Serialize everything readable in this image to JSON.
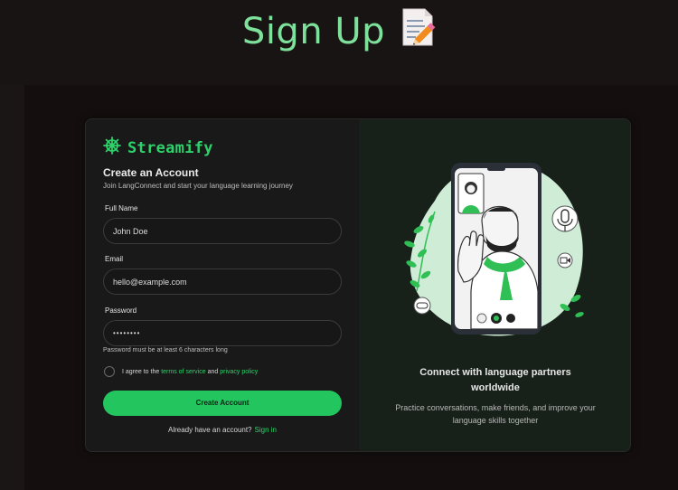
{
  "page": {
    "title": "Sign Up"
  },
  "brand": {
    "name": "Streamify",
    "color": "#2dd26a"
  },
  "form": {
    "heading": "Create an Account",
    "subheading": "Join LangConnect and start your language learning journey",
    "full_name": {
      "label": "Full Name",
      "value": "John Doe"
    },
    "email": {
      "label": "Email",
      "value": "hello@example.com"
    },
    "password": {
      "label": "Password",
      "value": "••••••••",
      "hint": "Password must be at least 6 characters long"
    },
    "agree": {
      "prefix": "I agree to the",
      "terms": "terms of service",
      "and": "and",
      "privacy": "privacy policy"
    },
    "submit_label": "Create Account",
    "signin_prompt": "Already have an account?",
    "signin_link": "Sign in"
  },
  "promo": {
    "title": "Connect with language partners worldwide",
    "text": "Practice conversations, make friends, and improve your language skills together"
  },
  "colors": {
    "accent": "#22c55e",
    "title": "#7ee19b",
    "background": "#1a1616"
  }
}
